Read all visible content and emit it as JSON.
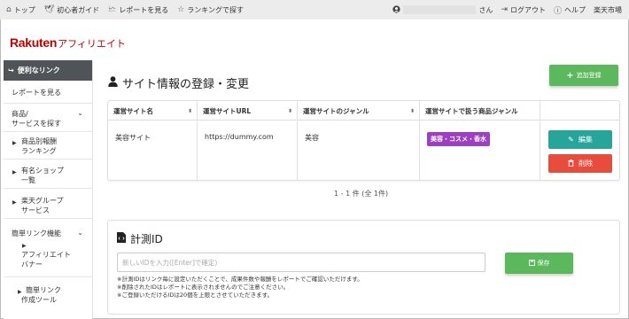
{
  "topbar": {
    "nav": [
      {
        "icon": "⌂",
        "label": "トップ"
      },
      {
        "icon": "🕊",
        "label": "初心者ガイド"
      },
      {
        "icon": "🗠",
        "label": "レポートを見る"
      },
      {
        "icon": "☆",
        "label": "ランキングで探す"
      }
    ],
    "user_suffix": "さん",
    "logout": "ログアウト",
    "help": "ヘルプ",
    "market": "楽天市場"
  },
  "logo": {
    "brand": "Rakuten",
    "sub": "アフィリエイト"
  },
  "sidebar": {
    "header": "便利なリンク",
    "report": "レポートを見る",
    "products_line1": "商品/",
    "products_line2": "サービスを探す",
    "sub1_line1": "商品別報酬",
    "sub1_line2": "ランキング",
    "sub2_line1": "有名ショップ",
    "sub2_line2": "一覧",
    "sub3_line1": "楽天グループ",
    "sub3_line2": "サービス",
    "easy_link": "簡単リンク機能",
    "sub4_line1": "アフィリエイト",
    "sub4_line2": "バナー",
    "sub5_line1": "簡単リンク",
    "sub5_line2": "作成ツール"
  },
  "main": {
    "title": "サイト情報の登録・変更",
    "add_button": "追加登録",
    "table": {
      "headers": [
        "運営サイト名",
        "運営サイトURL",
        "運営サイトのジャンル",
        "運営サイトで扱う商品ジャンル"
      ],
      "row": {
        "site_name": "美容サイト",
        "url": "https://dummy.com",
        "genre": "美容",
        "product_genre": "美容・コスメ・香水"
      },
      "edit_button": "編集",
      "delete_button": "削除"
    },
    "pager": "1 - 1 件 (全 1件)"
  },
  "measure": {
    "title": "計測ID",
    "placeholder": "新しいIDを入力([Enter]で確定)",
    "save_button": "保存",
    "notes": [
      "※計測IDはリンク毎に設定いただくことで、成果件数や報酬をレポートでご確認いただけます。",
      "※削除されたIDはレポートに表示されませんのでご注意ください。",
      "※ご登録いただけるIDは20個を上限とさせていただきます。"
    ]
  },
  "colors": {
    "brand": "#bf0000",
    "add_green": "#5cb85c",
    "edit_teal": "#26a69a",
    "delete_red": "#e74c3c",
    "badge_purple": "#9c3fc0",
    "sidebar_header": "#505458"
  }
}
